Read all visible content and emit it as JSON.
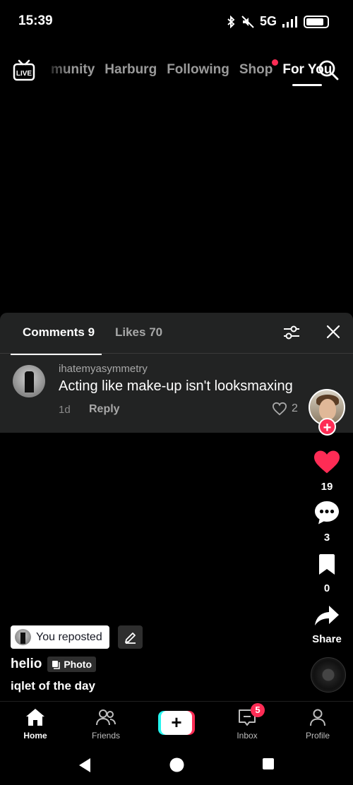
{
  "status_bar": {
    "time": "15:39",
    "network": "5G",
    "battery_percent": 85,
    "icons": [
      "bluetooth-icon",
      "mute-icon",
      "signal-icon",
      "battery-icon"
    ]
  },
  "top_nav": {
    "tabs": [
      "munity",
      "Harburg",
      "Following",
      "Shop",
      "For You"
    ],
    "active_tab": "For You",
    "shop_has_dot": true,
    "icons": [
      "live-icon",
      "search-icon"
    ]
  },
  "comments_panel": {
    "comments_tab": "Comments 9",
    "likes_tab": "Likes 70",
    "comment": {
      "username": "ihatemyasymmetry",
      "text": "Acting like make-up isn't looksmaxing",
      "time": "1d",
      "reply_label": "Reply",
      "likes": "2"
    }
  },
  "right_rail": {
    "likes_count": "19",
    "comments_count": "3",
    "favorites_count": "0",
    "share_label": "Share"
  },
  "post": {
    "reposted_label": "You reposted",
    "author": "helio",
    "photo_badge": "Photo",
    "caption": "iqlet of the day"
  },
  "bottom_tabs": {
    "home": "Home",
    "friends": "Friends",
    "inbox": "Inbox",
    "inbox_badge": "5",
    "profile": "Profile"
  },
  "colors": {
    "accent": "#fe2c55",
    "cyan": "#25f4ee",
    "sheet_bg": "#222323"
  }
}
